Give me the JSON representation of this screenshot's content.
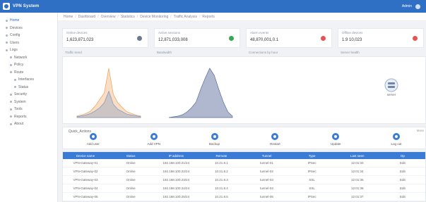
{
  "app": {
    "title": "VPN System",
    "user": "Admin"
  },
  "breadcrumb": [
    "Home",
    "Dashboard",
    "Overview",
    "Statistics",
    "Device Monitoring",
    "Traffic Analysis",
    "Reports"
  ],
  "sidebar": {
    "items": [
      {
        "label": "Home",
        "level": 0,
        "active": true
      },
      {
        "label": "Devices",
        "level": 0
      },
      {
        "label": "Config",
        "level": 0
      },
      {
        "label": "Users",
        "level": 0
      },
      {
        "label": "Logs",
        "level": 0
      },
      {
        "label": "Network",
        "level": 1
      },
      {
        "label": "Policy",
        "level": 1
      },
      {
        "label": "Route",
        "level": 1
      },
      {
        "label": "Interfaces",
        "level": 2
      },
      {
        "label": "Status",
        "level": 2
      },
      {
        "label": "Security",
        "level": 1
      },
      {
        "label": "System",
        "level": 1
      },
      {
        "label": "Tools",
        "level": 1
      },
      {
        "label": "Reports",
        "level": 1
      },
      {
        "label": "About",
        "level": 1
      }
    ]
  },
  "cards": [
    {
      "label": "Online devices",
      "value": "1,623,871,023",
      "icon": "device-icon",
      "color": "#6b7a8f"
    },
    {
      "label": "Active sessions",
      "value": "12,871,033,008",
      "icon": "session-icon",
      "color": "#34a853"
    },
    {
      "label": "Alarm events",
      "value": "48,870,001,0.1",
      "icon": "alarm-icon",
      "color": "#e55353"
    },
    {
      "label": "Offline devices",
      "value": "1.9 10,023",
      "icon": "offline-icon",
      "color": "#e55353"
    }
  ],
  "stat_tags": [
    "Traffic trend",
    "Bandwidth",
    "Connections by hour",
    "Server health"
  ],
  "chart_data": [
    {
      "type": "area",
      "x": [
        0,
        1,
        2,
        3,
        4,
        5,
        6,
        7,
        8,
        9,
        10,
        11,
        12,
        13,
        14
      ],
      "series": [
        {
          "values": [
            2,
            3,
            5,
            8,
            14,
            22,
            30,
            60,
            28,
            18,
            12,
            7,
            5,
            3,
            2
          ]
        },
        {
          "values": [
            1,
            2,
            3,
            5,
            8,
            12,
            18,
            32,
            16,
            10,
            7,
            4,
            3,
            2,
            1
          ]
        }
      ]
    },
    {
      "type": "area",
      "x": [
        0,
        1,
        2,
        3,
        4,
        5,
        6,
        7,
        8,
        9,
        10,
        11,
        12,
        13,
        14
      ],
      "series": [
        {
          "values": [
            0,
            1,
            2,
            4,
            8,
            14,
            22,
            40,
            56,
            70,
            60,
            40,
            22,
            8,
            2
          ]
        }
      ]
    }
  ],
  "server_widget": {
    "label": "server",
    "icon": "server-icon"
  },
  "quick": {
    "title": "Quick_Actions",
    "side_tag": "More",
    "items": [
      {
        "label": "Add user",
        "icon": "add-user-icon"
      },
      {
        "label": "Add VPN",
        "icon": "add-vpn-icon"
      },
      {
        "label": "Backup",
        "icon": "backup-icon"
      },
      {
        "label": "Restart",
        "icon": "restart-icon"
      },
      {
        "label": "Update",
        "icon": "update-icon"
      },
      {
        "label": "Log out",
        "icon": "logout-icon"
      }
    ]
  },
  "table": {
    "columns": [
      "Device name",
      "Status",
      "IP address",
      "Remote",
      "Tunnel",
      "Type",
      "Last seen",
      "Op"
    ],
    "rows": [
      [
        "VPN-Gateway-01",
        "Online",
        "192.168.100.21/24",
        "10.21.8.1",
        "tunnel-01",
        "IPSec",
        "12:01:33",
        "Edit"
      ],
      [
        "VPN-Gateway-02",
        "Online",
        "192.168.100.22/24",
        "10.21.8.2",
        "tunnel-02",
        "IPSec",
        "12:01:34",
        "Edit"
      ],
      [
        "VPN-Gateway-03",
        "Online",
        "192.168.100.23/24",
        "10.21.8.3",
        "tunnel-03",
        "SSL",
        "12:01:35",
        "Edit"
      ],
      [
        "VPN-Gateway-04",
        "Online",
        "192.168.100.24/24",
        "10.21.8.4",
        "tunnel-04",
        "SSL",
        "12:01:36",
        "Edit"
      ],
      [
        "VPN-Gateway-05",
        "Online",
        "192.168.100.25/24",
        "10.21.8.5",
        "tunnel-05",
        "IPSec",
        "12:01:37",
        "Edit"
      ]
    ]
  }
}
